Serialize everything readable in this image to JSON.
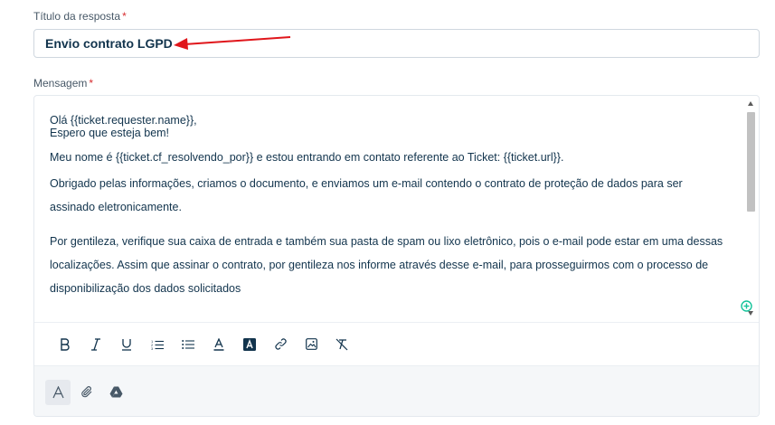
{
  "form": {
    "title_label": "Título da resposta",
    "required_mark": "*",
    "title_value": "Envio contrato LGPD",
    "message_label": "Mensagem"
  },
  "message": {
    "line1": "Olá {{ticket.requester.name}},",
    "line2": "Espero que esteja bem!",
    "line3": "Meu nome é {{ticket.cf_resolvendo_por}} e estou entrando em contato referente ao Ticket: {{ticket.url}}.",
    "para1": "Obrigado pelas informações, criamos o documento, e enviamos um e-mail contendo o contrato de proteção de dados para ser assinado eletronicamente.",
    "para2": "Por gentileza, verifique sua caixa de entrada e também sua pasta de spam ou lixo eletrônico, pois o e-mail pode estar em uma dessas localizações. Assim que assinar o contrato, por gentileza nos informe através desse e-mail, para prosseguirmos com o processo de disponibilização dos dados solicitados"
  },
  "toolbar": {
    "items": [
      "bold-icon",
      "italic-icon",
      "underline-icon",
      "numbered-list-icon",
      "bulleted-list-icon",
      "font-color-icon",
      "background-color-icon",
      "link-icon",
      "image-icon",
      "clear-format-icon"
    ]
  },
  "footer": {
    "items": [
      "text-format-icon",
      "attachment-icon",
      "google-drive-icon"
    ]
  },
  "colors": {
    "annotation_arrow": "#e0161b",
    "required": "#d72d30",
    "footer_bg": "#f5f7f9",
    "text": "#12344d"
  }
}
